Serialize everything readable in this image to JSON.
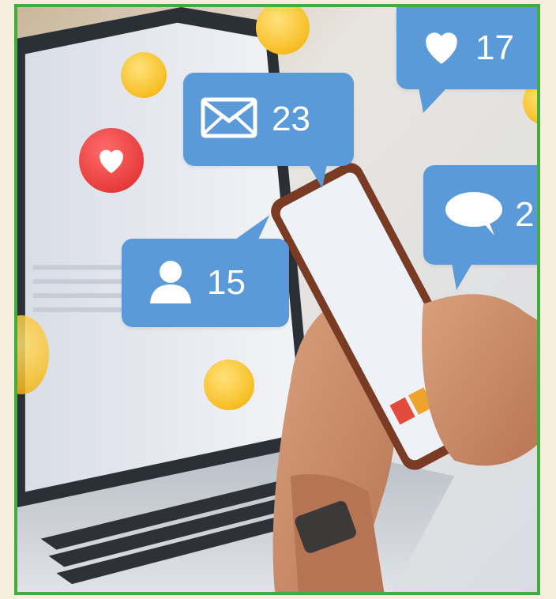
{
  "notifications": {
    "messages": {
      "icon": "envelope-icon",
      "count": "23"
    },
    "likes": {
      "icon": "heart-icon",
      "count": "17"
    },
    "followers": {
      "icon": "user-icon",
      "count": "15"
    },
    "comments": {
      "icon": "speech-bubble-icon",
      "count": "2"
    }
  },
  "colors": {
    "bubble": "#5b9ad9",
    "frame_border": "#3fae3a",
    "page_background": "#f6efe0"
  }
}
